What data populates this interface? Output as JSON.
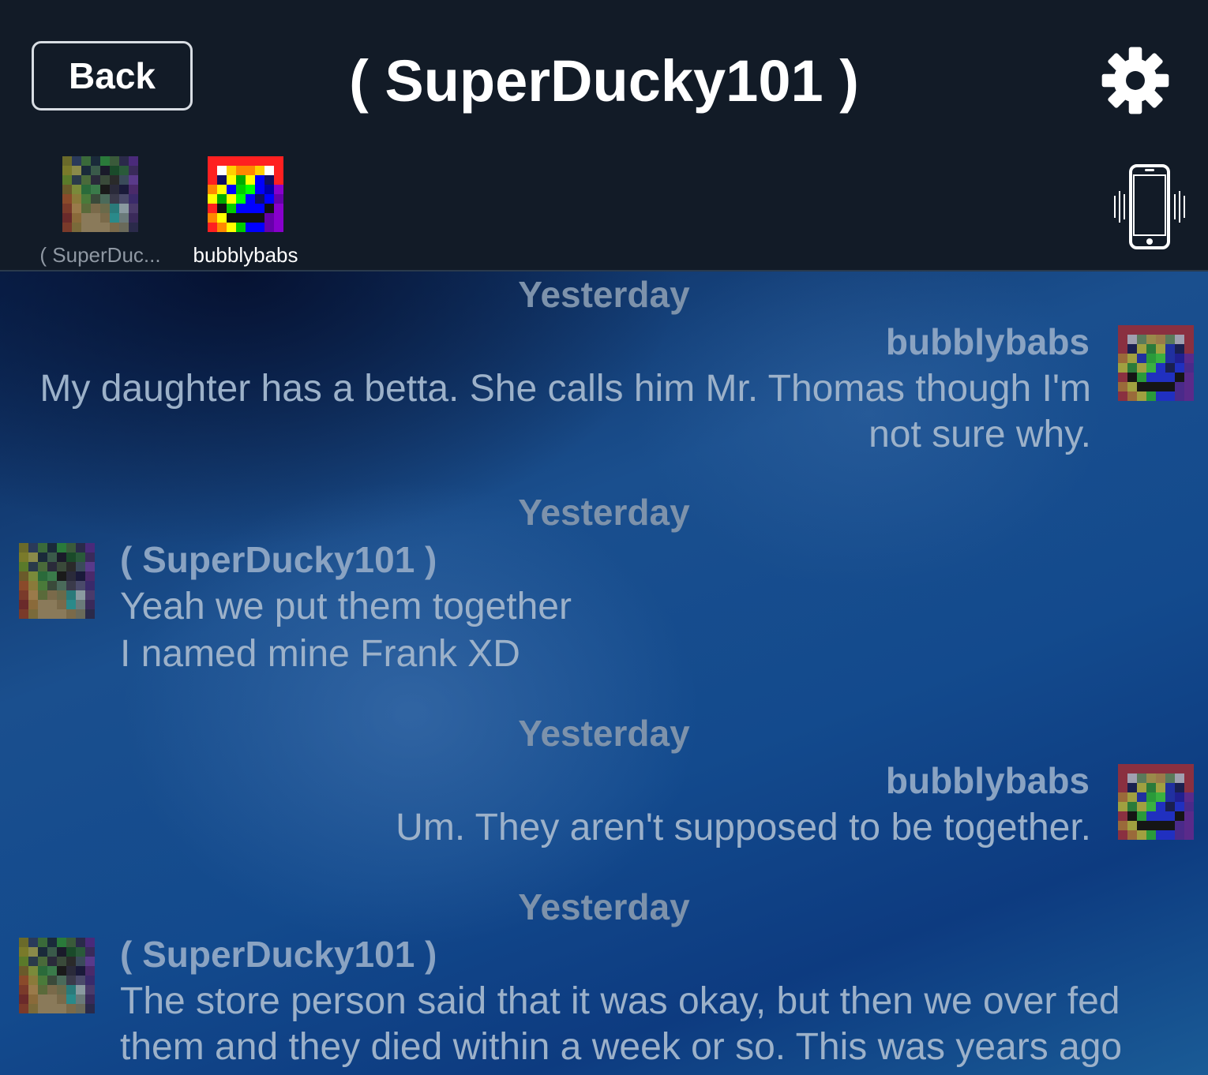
{
  "header": {
    "back_label": "Back",
    "title": "( SuperDucky101 )",
    "settings_icon": "gear-icon",
    "vibrate_icon": "phone-vibrate-icon"
  },
  "participants": [
    {
      "name": "( SuperDuc...",
      "active": false
    },
    {
      "name": "bubblybabs",
      "active": true
    }
  ],
  "messages": [
    {
      "timestamp": "Yesterday",
      "sender": "bubblybabs",
      "side": "right",
      "text": "My daughter has a betta.  She calls him Mr. Thomas though I'm not sure why."
    },
    {
      "timestamp": "Yesterday",
      "sender": "( SuperDucky101 )",
      "side": "left",
      "line1": "Yeah we put them together",
      "line2": "I named mine Frank XD"
    },
    {
      "timestamp": "Yesterday",
      "sender": "bubblybabs",
      "side": "right",
      "text": "Um.  They aren't supposed to be together."
    },
    {
      "timestamp": "Yesterday",
      "sender": "( SuperDucky101 )",
      "side": "left",
      "text": "The store person said that it was okay, but then we over fed them and they died within a week or so. This was years ago though"
    }
  ],
  "colors": {
    "header_bg": "#121b27",
    "chat_bg": "#134a8d",
    "timestamp": "#7d92ab",
    "sender": "#8aa3c2",
    "message": "#9cb1c9"
  }
}
